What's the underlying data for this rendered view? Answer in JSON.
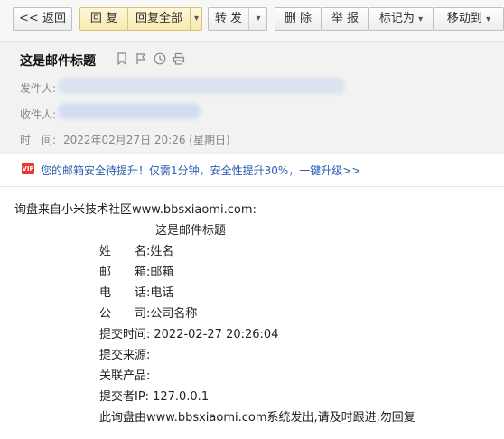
{
  "toolbar": {
    "back": "<< 返回",
    "reply": "回 复",
    "reply_all": "回复全部",
    "forward": "转 发",
    "delete": "删 除",
    "report": "举 报",
    "mark_as": "标记为",
    "move_to": "移动到"
  },
  "email": {
    "subject": "这是邮件标题",
    "from_label": "发件人:",
    "to_label": "收件人:",
    "time_label": "时　间:",
    "time_value": "2022年02月27日 20:26 (星期日)"
  },
  "notice": {
    "badge": "VIP",
    "text": "您的邮箱安全待提升！仅需1分钟，安全性提升30%，一键升级>>"
  },
  "body": {
    "intro": "询盘来自小米技术社区www.bbsxiaomi.com:",
    "title": "这是邮件标题",
    "rows": [
      {
        "label": "姓　　名:",
        "value": "姓名"
      },
      {
        "label": "邮　　箱:",
        "value": "邮箱"
      },
      {
        "label": "电　　话:",
        "value": "电话"
      },
      {
        "label": "公　　司:",
        "value": "公司名称"
      },
      {
        "label": "提交时间:",
        "value": "2022-02-27 20:26:04"
      },
      {
        "label": "提交来源:",
        "value": ""
      },
      {
        "label": "关联产品:",
        "value": ""
      },
      {
        "label": "提交者IP:",
        "value": "127.0.0.1"
      }
    ],
    "footer": "此询盘由www.bbsxiaomi.com系统发出,请及时跟进,勿回复"
  },
  "colors": {
    "notice_link": "#2a5db0",
    "vip_badge": "#e53a2e",
    "reply_group": "#f6e9b0"
  }
}
